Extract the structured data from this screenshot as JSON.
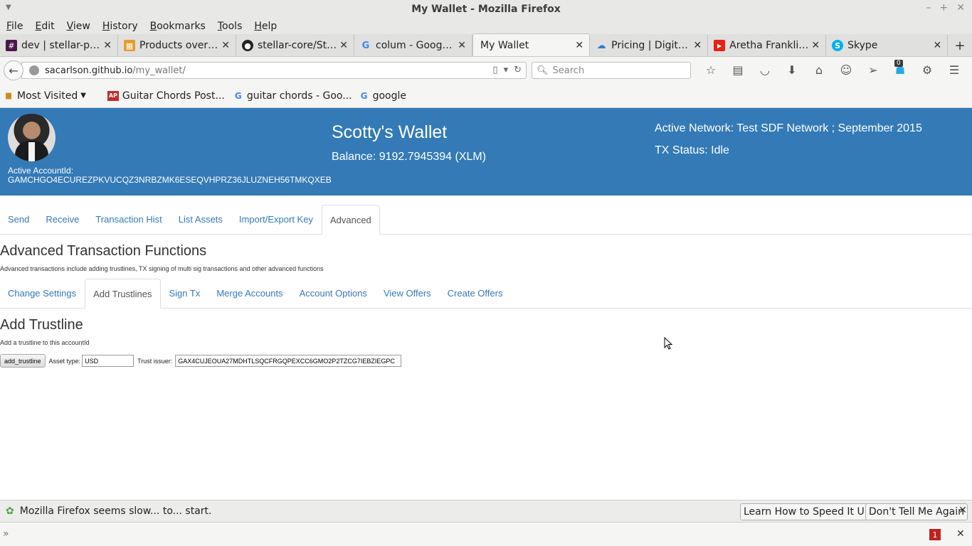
{
  "window": {
    "title": "My Wallet - Mozilla Firefox"
  },
  "menu": [
    "File",
    "Edit",
    "View",
    "History",
    "Bookmarks",
    "Tools",
    "Help"
  ],
  "tabs": [
    {
      "label": "dev | stellar-pu...",
      "icon": "hash-icon",
      "color": "#4a154b"
    },
    {
      "label": "Products overv...",
      "icon": "tiles-icon",
      "color": "#e89b2c"
    },
    {
      "label": "stellar-core/Ste...",
      "icon": "github-icon",
      "color": "#222222"
    },
    {
      "label": "colum - Google...",
      "icon": "google-icon",
      "color": "#4285f4"
    },
    {
      "label": "My Wallet",
      "icon": "",
      "color": ""
    },
    {
      "label": "Pricing | Digital...",
      "icon": "cloud-icon",
      "color": "#2d7fd3"
    },
    {
      "label": "Aretha Franklin...",
      "icon": "youtube-icon",
      "color": "#e62117"
    },
    {
      "label": "Skype",
      "icon": "skype-icon",
      "color": "#00aff0"
    }
  ],
  "url": {
    "host": "sacarlson.github.io",
    "path": "/my_wallet/"
  },
  "search": {
    "placeholder": "Search"
  },
  "toolbar_badge": "0",
  "bookmarks": [
    {
      "label": "Most Visited",
      "icon": "folder-icon"
    },
    {
      "label": "Guitar Chords Post...",
      "icon": "ap-icon"
    },
    {
      "label": "guitar chords - Goo...",
      "icon": "google-icon"
    },
    {
      "label": "google",
      "icon": "google-icon"
    }
  ],
  "wallet": {
    "title": "Scotty's Wallet",
    "balance": "Balance: 9192.7945394 (XLM)",
    "network": "Active Network: Test SDF Network ; September 2015",
    "tx_status": "TX Status: Idle",
    "account_label": "Active AccountId:",
    "account_id": "GAMCHGO4ECUREZPKVUCQZ3NRBZMK6ESEQVHPRZ36JLUZNEH56TMKQXEB",
    "header_color": "#337ab7"
  },
  "main_tabs": [
    {
      "label": "Send",
      "active": false
    },
    {
      "label": "Receive",
      "active": false
    },
    {
      "label": "Transaction Hist",
      "active": false
    },
    {
      "label": "List Assets",
      "active": false
    },
    {
      "label": "Import/Export Key",
      "active": false
    },
    {
      "label": "Advanced",
      "active": true
    }
  ],
  "advanced": {
    "title": "Advanced Transaction Functions",
    "description": "Advanced transactions include adding trustlines, TX signing of multi sig transactions and other advanced functions"
  },
  "sub_tabs": [
    {
      "label": "Change Settings",
      "active": false
    },
    {
      "label": "Add Trustlines",
      "active": true
    },
    {
      "label": "Sign Tx",
      "active": false
    },
    {
      "label": "Merge Accounts",
      "active": false
    },
    {
      "label": "Account Options",
      "active": false
    },
    {
      "label": "View Offers",
      "active": false
    },
    {
      "label": "Create Offers",
      "active": false
    }
  ],
  "trustline": {
    "title": "Add Trustline",
    "description": "Add a trustline to this accountId",
    "button": "add_trustline",
    "asset_label": "Asset type:",
    "asset_value": "USD",
    "issuer_label": "Trust issuer:",
    "issuer_value": "GAX4CUJEOUA27MDHTLSQCFRGQPEXCC6GMO2P2TZCG7IEBZIEGPC"
  },
  "notification": {
    "text": "Mozilla Firefox seems slow... to... start.",
    "learn_button": "Learn How to Speed It Up",
    "dismiss_button": "Don't Tell Me Again"
  },
  "console": {
    "error_count": "1"
  }
}
